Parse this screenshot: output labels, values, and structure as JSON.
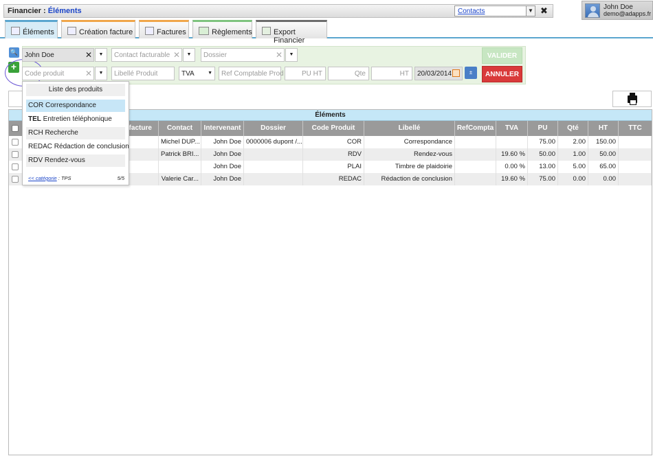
{
  "header": {
    "section": "Financier :",
    "page": "Éléments",
    "contacts_select": "Contacts",
    "close": "✖"
  },
  "user": {
    "name": "John Doe",
    "email": "demo@adapps.fr"
  },
  "tabs": [
    {
      "label": "Éléments",
      "icon": "list-icon"
    },
    {
      "label": "Création facture",
      "icon": "document-icon"
    },
    {
      "label": "Factures",
      "icon": "document-icon"
    },
    {
      "label": "Règlements",
      "icon": "money-icon"
    },
    {
      "label": "Export Financier",
      "icon": "export-icon"
    }
  ],
  "form": {
    "client_value": "John Doe",
    "contact_placeholder": "Contact facturable",
    "dossier_placeholder": "Dossier",
    "code_placeholder": "Code produit",
    "libelle_placeholder": "Libellé Produit",
    "tva_value": "TVA",
    "ref_placeholder": "Ref Comptable Prod",
    "pu_placeholder": "PU HT",
    "qte_placeholder": "Qte",
    "ht_placeholder": "HT",
    "date_value": "20/03/2014",
    "valider": "VALIDER",
    "annuler": "ANNULER"
  },
  "dropdown": {
    "title": "Liste des produits",
    "items": [
      {
        "code": "COR",
        "label": "Correspondance"
      },
      {
        "code": "TEL",
        "label": "Entretien téléphonique"
      },
      {
        "code": "RCH",
        "label": "Recherche"
      },
      {
        "code": "REDAC",
        "label": "Rédaction de conclusion"
      },
      {
        "code": "RDV",
        "label": "Rendez-vous"
      }
    ],
    "footer_link": "<< catégorie",
    "footer_cat": ": TPS",
    "footer_count": "5/5"
  },
  "table": {
    "title": "Éléments",
    "columns": [
      "",
      "",
      "efacture",
      "Contact",
      "Intervenant",
      "Dossier",
      "Code Produit",
      "Libellé",
      "RefCompta",
      "TVA",
      "PU",
      "Qté",
      "HT",
      "TTC"
    ],
    "rows": [
      [
        "",
        "",
        "",
        "Michel DUP...",
        "John Doe",
        "0000006 dupont /...",
        "COR",
        "Correspondance",
        "",
        "",
        "75.00",
        "2.00",
        "150.00",
        ""
      ],
      [
        "",
        "",
        "",
        "Patrick BRI...",
        "John Doe",
        "",
        "RDV",
        "Rendez-vous",
        "",
        "19.60 %",
        "50.00",
        "1.00",
        "50.00",
        ""
      ],
      [
        "",
        "",
        "",
        "",
        "John Doe",
        "",
        "PLAI",
        "Timbre de plaidoirie",
        "",
        "0.00 %",
        "13.00",
        "5.00",
        "65.00",
        ""
      ],
      [
        "",
        "",
        "",
        "Valerie Car...",
        "John Doe",
        "",
        "REDAC",
        "Rédaction de conclusion",
        "",
        "19.60 %",
        "75.00",
        "0.00",
        "0.00",
        ""
      ]
    ]
  },
  "colors": {
    "accent": "#5aa6cf",
    "danger": "#d93a3a",
    "success": "#c7e6c2"
  }
}
